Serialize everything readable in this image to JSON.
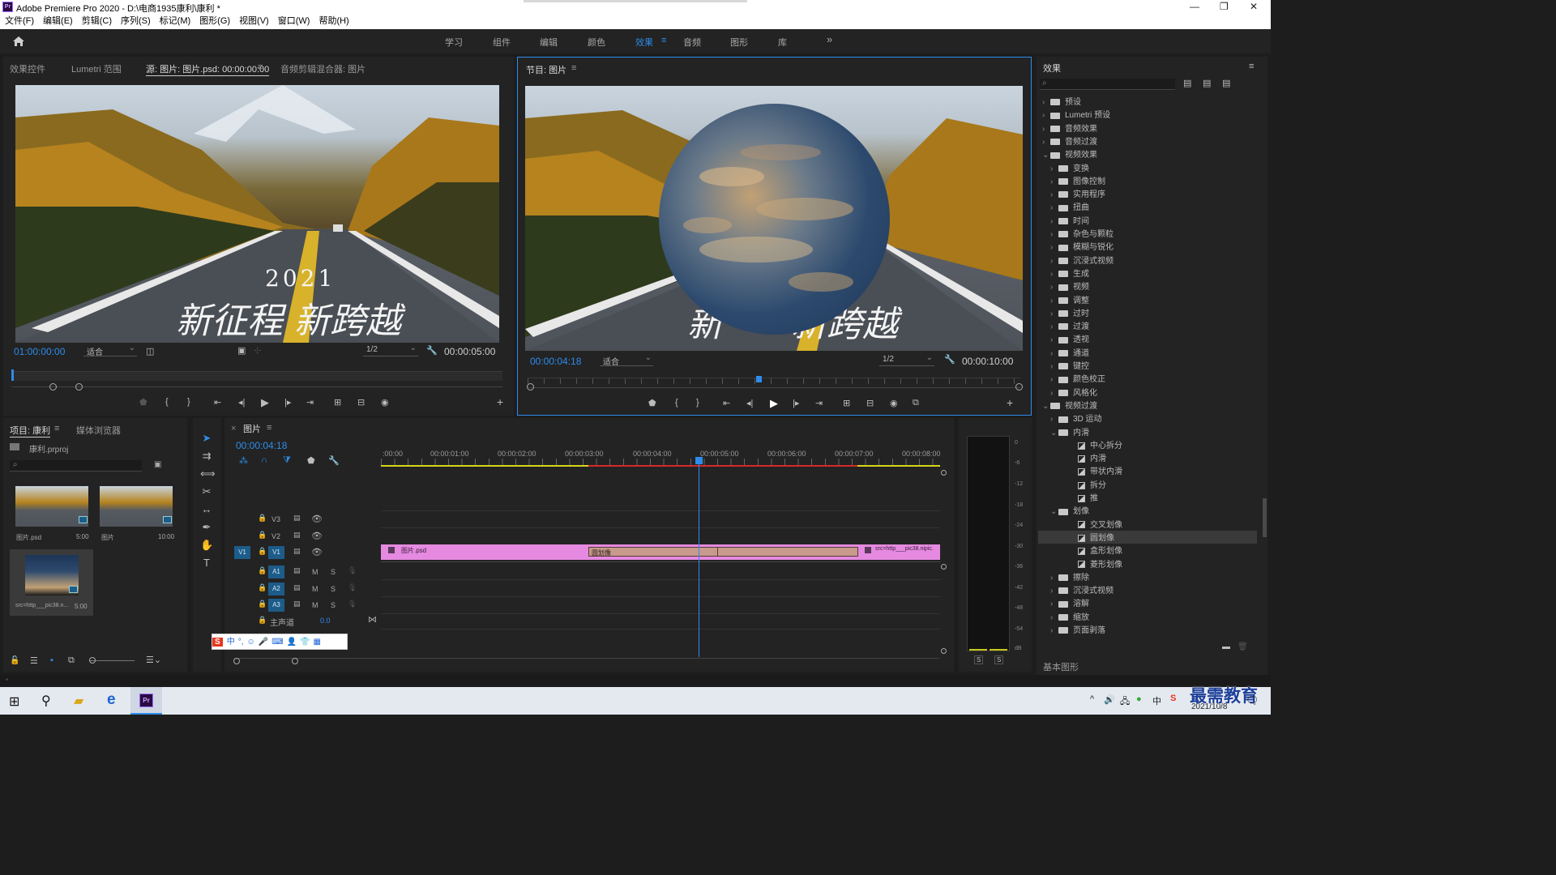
{
  "window": {
    "title": "Adobe Premiere Pro 2020 - D:\\电商1935康利\\康利 *",
    "logo": "Pr"
  },
  "menu": [
    "文件(F)",
    "编辑(E)",
    "剪辑(C)",
    "序列(S)",
    "标记(M)",
    "图形(G)",
    "视图(V)",
    "窗口(W)",
    "帮助(H)"
  ],
  "workspaces": {
    "items": [
      "学习",
      "组件",
      "编辑",
      "颜色",
      "效果",
      "音频",
      "图形",
      "库"
    ],
    "active": "效果",
    "more": "»"
  },
  "source_panel": {
    "tabs": [
      "效果控件",
      "Lumetri 范围",
      "源: 图片: 图片.psd: 00:00:00:00",
      "音频剪辑混合器: 图片"
    ],
    "active_tab": "源: 图片: 图片.psd: 00:00:00:00",
    "timecode": "01:00:00:00",
    "fit": "适合",
    "resolution": "1/2",
    "duration": "00:00:05:00",
    "overlay_year": "2021",
    "overlay_text": "新征程 新跨越"
  },
  "program_panel": {
    "tab": "节目: 图片",
    "timecode": "00:00:04:18",
    "fit": "适合",
    "resolution": "1/2",
    "duration": "00:00:10:00",
    "overlay_text": "新 新跨越"
  },
  "project_panel": {
    "tabs": [
      "项目: 康利",
      "媒体浏览器"
    ],
    "project_file": "康利.prproj",
    "items": [
      {
        "name": "图片.psd",
        "duration": "5:00"
      },
      {
        "name": "图片",
        "duration": "10:00"
      },
      {
        "name": "src=http___pic38.n...",
        "duration": "5:00"
      }
    ]
  },
  "timeline": {
    "tab": "图片",
    "timecode": "00:00:04:18",
    "ruler": [
      ":00:00",
      "00:00:01:00",
      "00:00:02:00",
      "00:00:03:00",
      "00:00:04:00",
      "00:00:05:00",
      "00:00:06:00",
      "00:00:07:00",
      "00:00:08:00"
    ],
    "video_tracks": [
      "V3",
      "V2",
      "V1"
    ],
    "audio_tracks": [
      "A1",
      "A2",
      "A3"
    ],
    "master": {
      "label": "主声道",
      "value": "0.0"
    },
    "clips": {
      "clip1": "图片.psd",
      "transition": "圆划像",
      "clip2": "src=http___pic38.nipic."
    },
    "audio_btns": {
      "m": "M",
      "s": "S"
    }
  },
  "audio_meter": {
    "scale": [
      "0",
      "-6",
      "-12",
      "-18",
      "-24",
      "-30",
      "-36",
      "-42",
      "-48",
      "-54",
      "dB"
    ],
    "solo": [
      "S",
      "S"
    ]
  },
  "effects_panel": {
    "title": "效果",
    "tree": [
      {
        "label": "预设",
        "level": 0,
        "type": "folder",
        "open": false
      },
      {
        "label": "Lumetri 预设",
        "level": 0,
        "type": "folder",
        "open": false
      },
      {
        "label": "音频效果",
        "level": 0,
        "type": "folder",
        "open": false
      },
      {
        "label": "音频过渡",
        "level": 0,
        "type": "folder",
        "open": false
      },
      {
        "label": "视频效果",
        "level": 0,
        "type": "folder",
        "open": true
      },
      {
        "label": "变换",
        "level": 1,
        "type": "folder",
        "open": false
      },
      {
        "label": "图像控制",
        "level": 1,
        "type": "folder",
        "open": false
      },
      {
        "label": "实用程序",
        "level": 1,
        "type": "folder",
        "open": false
      },
      {
        "label": "扭曲",
        "level": 1,
        "type": "folder",
        "open": false
      },
      {
        "label": "时间",
        "level": 1,
        "type": "folder",
        "open": false
      },
      {
        "label": "杂色与颗粒",
        "level": 1,
        "type": "folder",
        "open": false
      },
      {
        "label": "模糊与锐化",
        "level": 1,
        "type": "folder",
        "open": false
      },
      {
        "label": "沉浸式视频",
        "level": 1,
        "type": "folder",
        "open": false
      },
      {
        "label": "生成",
        "level": 1,
        "type": "folder",
        "open": false
      },
      {
        "label": "视频",
        "level": 1,
        "type": "folder",
        "open": false
      },
      {
        "label": "调整",
        "level": 1,
        "type": "folder",
        "open": false
      },
      {
        "label": "过时",
        "level": 1,
        "type": "folder",
        "open": false
      },
      {
        "label": "过渡",
        "level": 1,
        "type": "folder",
        "open": false
      },
      {
        "label": "透视",
        "level": 1,
        "type": "folder",
        "open": false
      },
      {
        "label": "通道",
        "level": 1,
        "type": "folder",
        "open": false
      },
      {
        "label": "键控",
        "level": 1,
        "type": "folder",
        "open": false
      },
      {
        "label": "颜色校正",
        "level": 1,
        "type": "folder",
        "open": false
      },
      {
        "label": "风格化",
        "level": 1,
        "type": "folder",
        "open": false
      },
      {
        "label": "视频过渡",
        "level": 0,
        "type": "folder",
        "open": true
      },
      {
        "label": "3D 运动",
        "level": 1,
        "type": "folder",
        "open": false
      },
      {
        "label": "内滑",
        "level": 1,
        "type": "folder",
        "open": true
      },
      {
        "label": "中心拆分",
        "level": 2,
        "type": "fx"
      },
      {
        "label": "内滑",
        "level": 2,
        "type": "fx"
      },
      {
        "label": "带状内滑",
        "level": 2,
        "type": "fx"
      },
      {
        "label": "拆分",
        "level": 2,
        "type": "fx"
      },
      {
        "label": "推",
        "level": 2,
        "type": "fx"
      },
      {
        "label": "划像",
        "level": 1,
        "type": "folder",
        "open": true
      },
      {
        "label": "交叉划像",
        "level": 2,
        "type": "fx"
      },
      {
        "label": "圆划像",
        "level": 2,
        "type": "fx",
        "selected": true
      },
      {
        "label": "盒形划像",
        "level": 2,
        "type": "fx"
      },
      {
        "label": "菱形划像",
        "level": 2,
        "type": "fx"
      },
      {
        "label": "擦除",
        "level": 1,
        "type": "folder",
        "open": false
      },
      {
        "label": "沉浸式视频",
        "level": 1,
        "type": "folder",
        "open": false
      },
      {
        "label": "溶解",
        "level": 1,
        "type": "folder",
        "open": false
      },
      {
        "label": "缩放",
        "level": 1,
        "type": "folder",
        "open": false
      },
      {
        "label": "页面剥落",
        "level": 1,
        "type": "folder",
        "open": false
      }
    ],
    "bottom_tab": "基本图形"
  },
  "ime_bar": {
    "items": [
      "中",
      "°,",
      "☺",
      "🎤",
      "⌨",
      "👤",
      "👕",
      "▦"
    ]
  },
  "taskbar": {
    "date": "2021/10/8",
    "watermark": "最需教育"
  },
  "colors": {
    "accent": "#2d8ceb",
    "clip": "#e58ae0",
    "transition": "#c79a8c",
    "tracktag": "#1d5c89"
  }
}
